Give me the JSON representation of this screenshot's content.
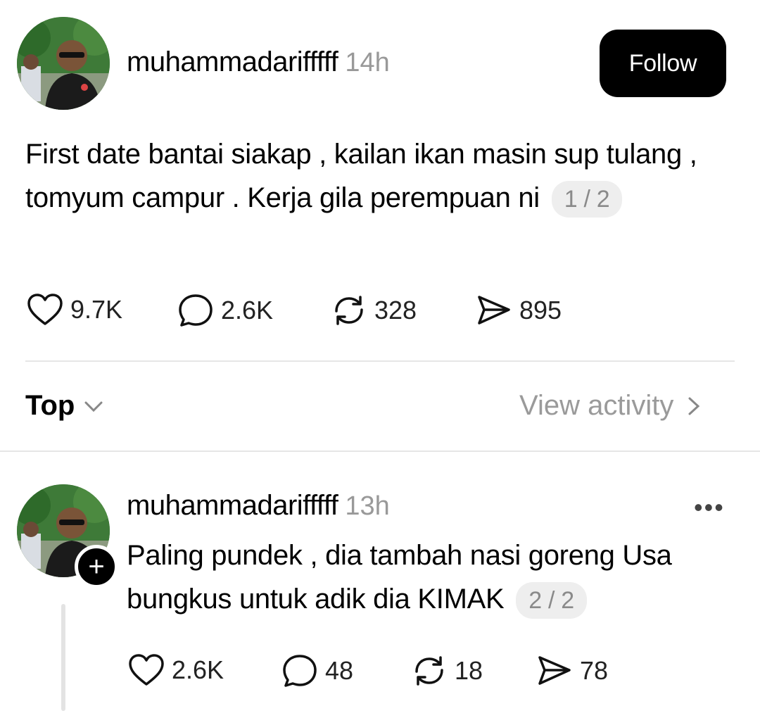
{
  "main_post": {
    "username": "muhammadarifffff",
    "time": "14h",
    "follow_label": "Follow",
    "text": "First date bantai siakap , kailan ikan masin sup tulang , tomyum campur . Kerja gila perempuan ni",
    "counter": "1 / 2",
    "stats": {
      "likes": "9.7K",
      "comments": "2.6K",
      "reposts": "328",
      "shares": "895"
    }
  },
  "sort_bar": {
    "label": "Top",
    "view_activity": "View activity"
  },
  "reply": {
    "username": "muhammadarifffff",
    "time": "13h",
    "more": "•••",
    "text": "Paling pundek , dia tambah nasi goreng Usa bungkus untuk adik dia KIMAK",
    "counter": "2 / 2",
    "stats": {
      "likes": "2.6K",
      "comments": "48",
      "reposts": "18",
      "shares": "78"
    }
  },
  "icons": [
    "heart-icon",
    "comment-icon",
    "repost-icon",
    "share-icon",
    "chevron-down-icon",
    "chevron-right-icon",
    "plus-icon",
    "more-icon"
  ]
}
